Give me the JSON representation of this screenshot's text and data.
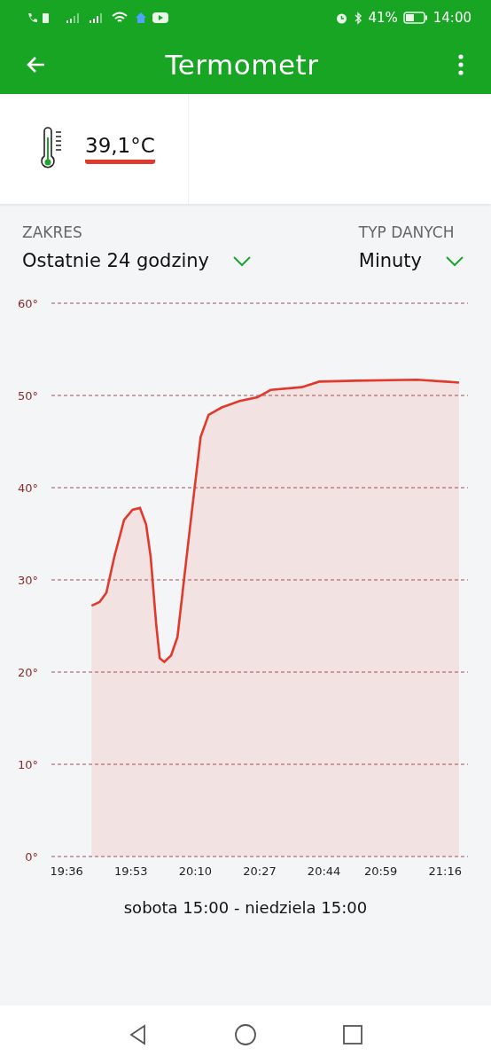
{
  "status_bar": {
    "battery_text": "41%",
    "time": "14:00"
  },
  "app_bar": {
    "title": "Termometr"
  },
  "reading": {
    "value": "39,1°C"
  },
  "filters": [
    {
      "label": "ZAKRES",
      "value": "Ostatnie 24 godziny"
    },
    {
      "label": "TYP DANYCH",
      "value": "Minuty"
    }
  ],
  "chart": {
    "chart_data": {
      "type": "area",
      "x": [
        19.71,
        19.745,
        19.775,
        19.81,
        19.853,
        19.89,
        19.923,
        19.95,
        19.97,
        19.995,
        20.01,
        20.03,
        20.06,
        20.088,
        20.147,
        20.19,
        20.225,
        20.283,
        20.362,
        20.44,
        20.498,
        20.635,
        20.712,
        20.868,
        21.142,
        21.328
      ],
      "xlim": [
        19.533,
        21.367
      ],
      "grid": true,
      "series": [
        {
          "color": "#e03a2c",
          "values": [
            27.2,
            27.6,
            28.6,
            32.5,
            36.5,
            37.6,
            37.8,
            36,
            32.5,
            25,
            21.5,
            21.1,
            21.8,
            23.8,
            36.5,
            45.5,
            47.9,
            48.7,
            49.4,
            49.8,
            50.6,
            50.9,
            51.5,
            51.6,
            51.7,
            51.4
          ]
        }
      ],
      "ylim": [
        0,
        60
      ],
      "yticks": [
        {
          "value": 0,
          "label": "0°"
        },
        {
          "value": 10,
          "label": "10°"
        },
        {
          "value": 20,
          "label": "20°"
        },
        {
          "value": 30,
          "label": "30°"
        },
        {
          "value": 40,
          "label": "40°"
        },
        {
          "value": 50,
          "label": "50°"
        },
        {
          "value": 60,
          "label": "60°"
        }
      ],
      "xticks": [
        {
          "value": 19.6,
          "label": "19:36"
        },
        {
          "value": 19.8833,
          "label": "19:53"
        },
        {
          "value": 20.1667,
          "label": "20:10"
        },
        {
          "value": 20.45,
          "label": "20:27"
        },
        {
          "value": 20.7333,
          "label": "20:44"
        },
        {
          "value": 20.9833,
          "label": "20:59"
        },
        {
          "value": 21.2667,
          "label": "21:16"
        }
      ]
    },
    "period": "sobota 15:00 - niedziela 15:00"
  }
}
